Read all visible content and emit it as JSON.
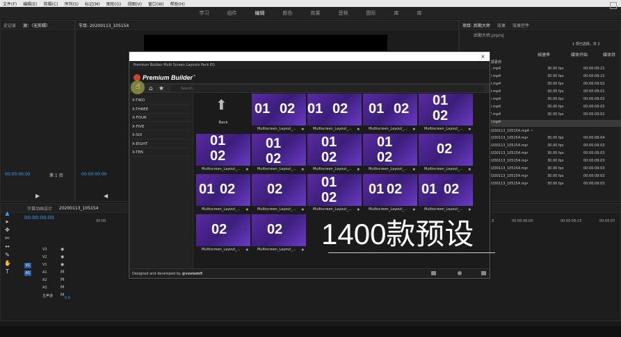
{
  "menubar": {
    "items": [
      "文件(F)",
      "编辑(E)",
      "剪辑(C)",
      "序列(S)",
      "标记(M)",
      "图形(G)",
      "视图(V)",
      "窗口(W)",
      "帮助(H)"
    ]
  },
  "workspace": {
    "tabs": [
      "学习",
      "组件",
      "编辑",
      "颜色",
      "效果",
      "音频",
      "图形",
      "库",
      "库"
    ],
    "active": "编辑"
  },
  "source": {
    "tab_history": "史记录",
    "tab_source": "源：（无剪辑）",
    "timecode": "00:00:00:00",
    "page": "第 1 页"
  },
  "program": {
    "tab": "节目: 20200113_105154",
    "timecode": "00:00:00:00"
  },
  "project": {
    "tabs": [
      "项目: 后期大师",
      "效果",
      "效果控件"
    ],
    "title": "后期大师.prproj",
    "selection": "1 项已选择，共 2",
    "col_fps": "帧速率",
    "col_start": "媒体开始",
    "col_dur": "媒体持",
    "bin_1": "分屏素材",
    "bin_2": "20200113_105154.mp4 ~",
    "files": [
      {
        "name": "a1.mp4",
        "fps": "30.00 fps",
        "start": "00:00:09:21"
      },
      {
        "name": "a2.mp4",
        "fps": "30.00 fps",
        "start": "00:00:09:21"
      },
      {
        "name": "a3.mp4",
        "fps": "30.00 fps",
        "start": "00:00:09:02"
      },
      {
        "name": "a4.mp4",
        "fps": "30.00 fps",
        "start": "00:00:09:01"
      },
      {
        "name": "a5.mp4",
        "fps": "30.00 fps",
        "start": "00:00:09:02"
      },
      {
        "name": "a6.mp4",
        "fps": "30.00 fps",
        "start": "00:00:09:02"
      },
      {
        "name": "a7.mp4",
        "fps": "30.00 fps",
        "start": "00:00:09:02"
      },
      {
        "name": "a8.mp4",
        "fps": "",
        "start": ""
      }
    ],
    "files2": [
      {
        "name": "20200113_105154.mp4",
        "fps": "30.00 fps",
        "start": "00:00:09:04"
      },
      {
        "name": "20200113_105154.mp4",
        "fps": "30.00 fps",
        "start": "00:00:09:03"
      },
      {
        "name": "20200113_105154.mp4",
        "fps": "30.00 fps",
        "start": "00:00:09:03"
      },
      {
        "name": "20200113_105154.mp4",
        "fps": "30.00 fps",
        "start": "00:00:09:03"
      },
      {
        "name": "20200113_105154.mp4",
        "fps": "30.00 fps",
        "start": "00:00:09:03"
      },
      {
        "name": "20200113_105154.mp4",
        "fps": "30.00 fps",
        "start": "00:00:09:03"
      },
      {
        "name": "20200113_105154.mp4",
        "fps": "30.00 fps",
        "start": "00:00:09:03"
      }
    ]
  },
  "timeline": {
    "tab_lib": "字幕动画设计",
    "tab_seq": "20200113_105154",
    "timecode": "00:00:00:00",
    "ruler": [
      "00:00",
      "00:00:05:15",
      "00:00:06:00",
      "00:00:06:15",
      "00:00:07"
    ],
    "tracks": [
      {
        "id": "V3",
        "badge": ""
      },
      {
        "id": "V2",
        "badge": ""
      },
      {
        "id": "V1",
        "badge": "V1"
      },
      {
        "id": "A1",
        "badge": "A1"
      },
      {
        "id": "A2",
        "badge": ""
      },
      {
        "id": "A3",
        "badge": ""
      },
      {
        "id": "主声道",
        "badge": ""
      }
    ],
    "master_value": "0.0"
  },
  "modal": {
    "header": "Premium Builder Multi Screen Layouts Pack EG",
    "brand": "Premium Builder",
    "brand_tm": "™",
    "search_placeholder": "Search...",
    "sidebar_items": [
      "X-TWO",
      "X-THREE",
      "X-FOUR",
      "X-FIVE",
      "X-SIX",
      "X-EIGHT",
      "X-TEN"
    ],
    "back_label": "Back",
    "tile_caption": "Multiscreen_Layout_...",
    "footer": "Designed and developed by",
    "footer_author": "@voxiumlt"
  },
  "tiles": [
    {
      "nums": [
        [
          "01",
          4,
          12
        ],
        [
          "02",
          40,
          12
        ]
      ]
    },
    {
      "nums": [
        [
          "01",
          0,
          12
        ],
        [
          "02",
          36,
          12
        ]
      ]
    },
    {
      "nums": [
        [
          "01",
          8,
          12
        ],
        [
          "02",
          44,
          12
        ]
      ]
    },
    {
      "nums": [
        [
          "01",
          20,
          0
        ],
        [
          "02",
          20,
          22
        ]
      ]
    },
    {
      "nums": [
        [
          "01",
          20,
          0
        ],
        [
          "02",
          20,
          22
        ]
      ]
    },
    {
      "nums": [
        [
          "01",
          20,
          4
        ],
        [
          "02",
          20,
          26
        ]
      ]
    },
    {
      "nums": [
        [
          "01",
          20,
          2
        ],
        [
          "02",
          20,
          24
        ]
      ]
    },
    {
      "nums": [
        [
          "01",
          20,
          2
        ],
        [
          "02",
          20,
          24
        ]
      ]
    },
    {
      "nums": [
        [
          "02",
          26,
          12
        ]
      ]
    },
    {
      "nums": [
        [
          "01",
          4,
          12
        ],
        [
          "02",
          34,
          12
        ]
      ]
    },
    {
      "nums": [
        [
          "02",
          22,
          12
        ]
      ]
    },
    {
      "nums": [
        [
          "01",
          20,
          2
        ],
        [
          "02",
          20,
          24
        ]
      ]
    },
    {
      "nums": [
        [
          "01",
          8,
          12
        ],
        [
          "02",
          34,
          12
        ]
      ]
    },
    {
      "nums": [
        [
          "01",
          4,
          12
        ],
        [
          "02",
          36,
          12
        ]
      ]
    },
    {
      "nums": [
        [
          "02",
          22,
          12
        ]
      ]
    },
    {
      "nums": [
        [
          "02",
          22,
          12
        ]
      ]
    }
  ],
  "overlay": {
    "caption": "1400款预设"
  },
  "colors": {
    "accent": "#3aa0ff",
    "tile_purple": "#5a2aa0"
  }
}
